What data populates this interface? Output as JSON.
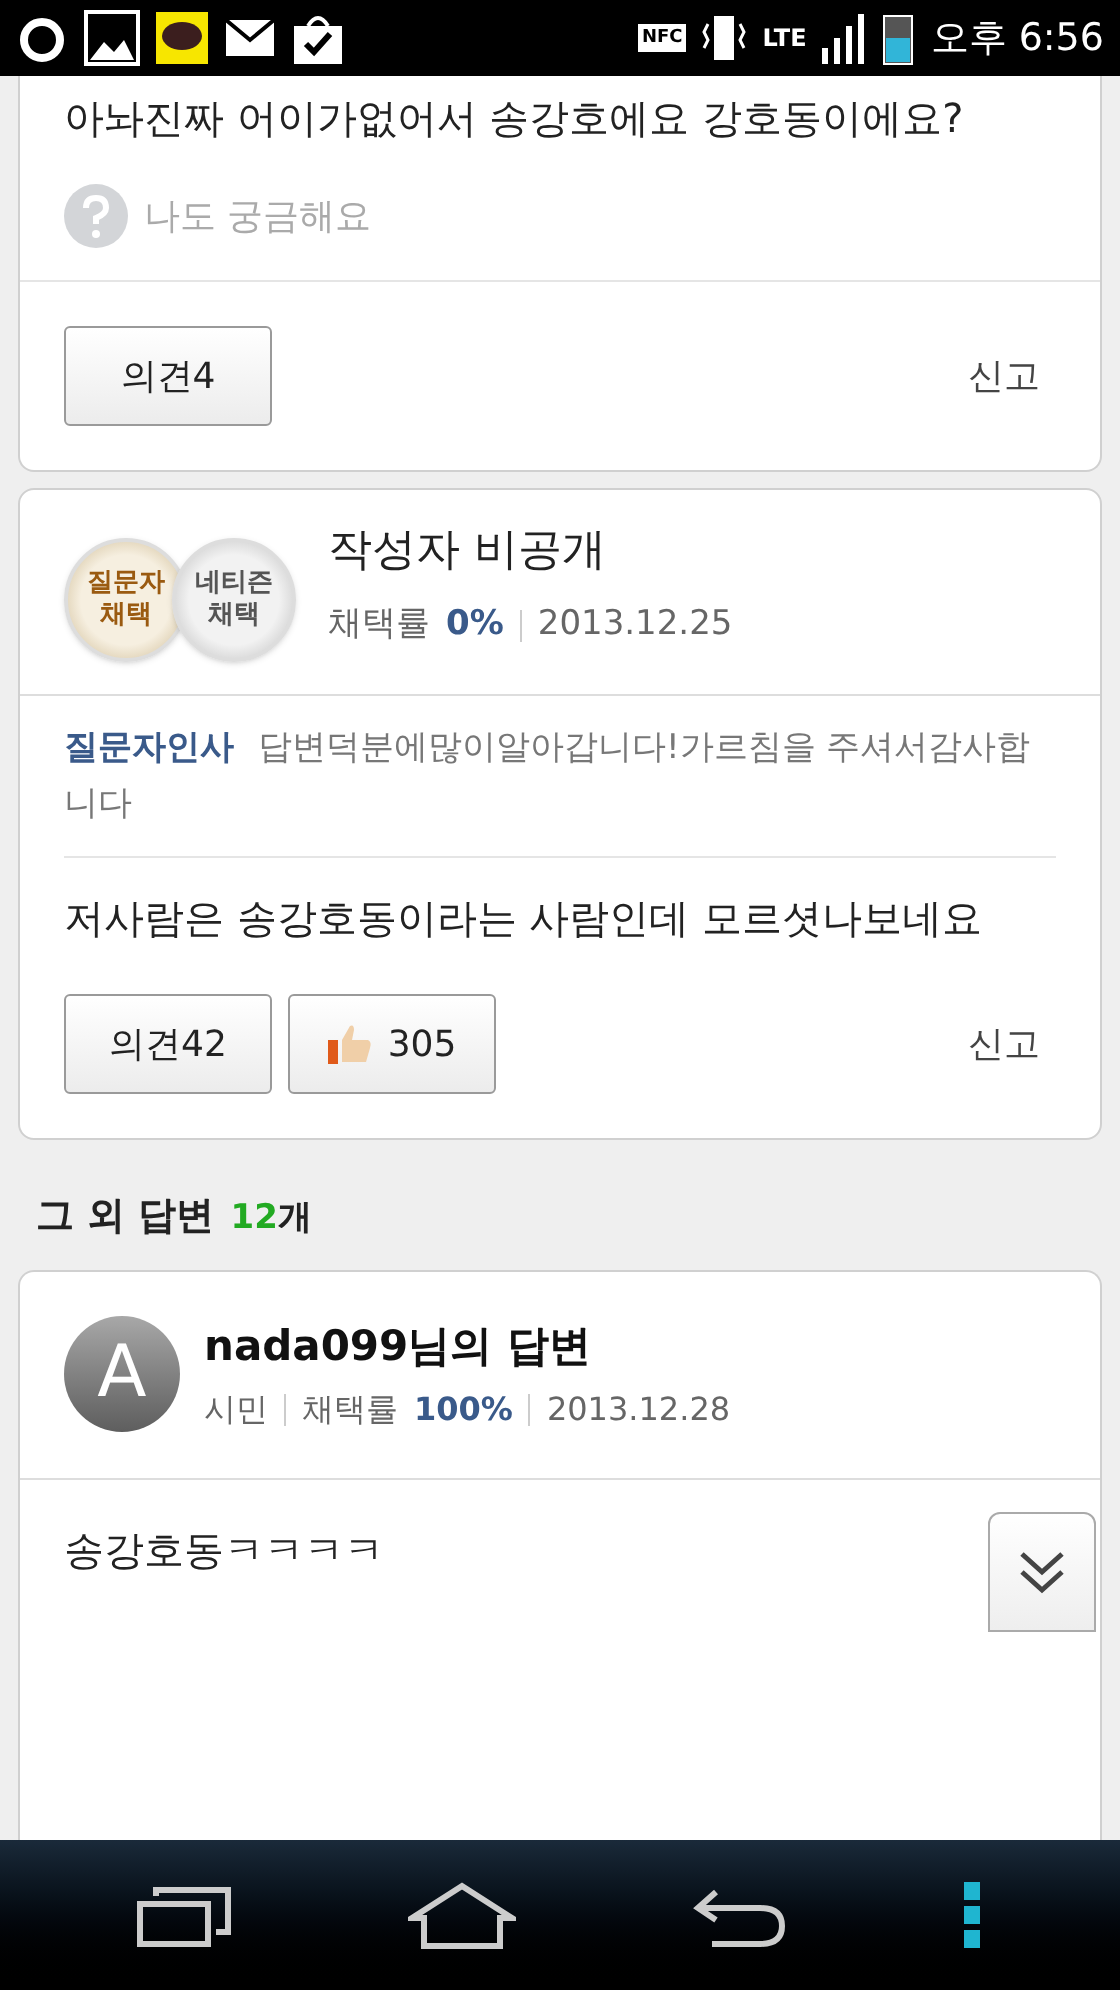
{
  "status_bar": {
    "nfc": "NFC",
    "network": "LTE",
    "time": "오후 6:56"
  },
  "question_tail": {
    "text": "아놔진짜 어이가없어서 송강호에요 강호동이에요?",
    "curious": "나도 궁금해요",
    "comments": "의견4",
    "report": "신고"
  },
  "selected_answer": {
    "badges": [
      {
        "kind": "gold",
        "top": "질문자",
        "bottom": "채택"
      },
      {
        "kind": "silver",
        "top": "네티즌",
        "bottom": "채택"
      }
    ],
    "author": "작성자 비공개",
    "rate_label": "채택률",
    "rate": "0%",
    "date": "2013.12.25",
    "greeting_label": "질문자인사",
    "greeting": "답변덕분에많이알아갑니다!가르침을 주셔서감사합니다",
    "body": "저사람은 송강호동이라는 사람인데 모르셧나보네요",
    "comments": "의견42",
    "likes": "305",
    "report": "신고"
  },
  "other_answers": {
    "heading": "그 외 답변",
    "count": "12",
    "unit": "개"
  },
  "answer": {
    "avatar": "A",
    "title": "nada099님의 답변",
    "grade": "시민",
    "rate_label": "채택률",
    "rate": "100%",
    "date": "2013.12.28",
    "body": "송강호동ㅋㅋㅋㅋ"
  }
}
